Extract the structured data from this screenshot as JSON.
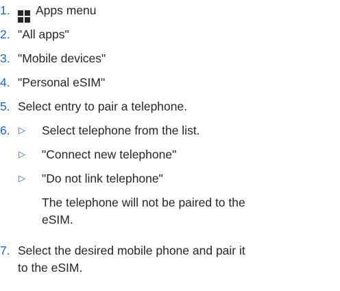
{
  "steps": [
    {
      "num": "1.",
      "text": "Apps menu"
    },
    {
      "num": "2.",
      "text": "\"All apps\""
    },
    {
      "num": "3.",
      "text": "\"Mobile devices\""
    },
    {
      "num": "4.",
      "text": "\"Personal eSIM\""
    },
    {
      "num": "5.",
      "text": "Select entry to pair a telephone."
    },
    {
      "num": "6.",
      "text": "Select telephone from the list."
    },
    {
      "num": "7.",
      "text_line1": "Select the desired mobile phone and pair it",
      "text_line2": "to the eSIM."
    }
  ],
  "sub_options": [
    "\"Connect new telephone\"",
    "\"Do not link telephone\""
  ],
  "note": {
    "line1": "The telephone will not be paired to the",
    "line2": "eSIM."
  },
  "bullet_glyph": "▷",
  "icons": {
    "apps": "apps-grid-icon"
  },
  "colors": {
    "accent": "#1c69d4",
    "text": "#262626"
  }
}
